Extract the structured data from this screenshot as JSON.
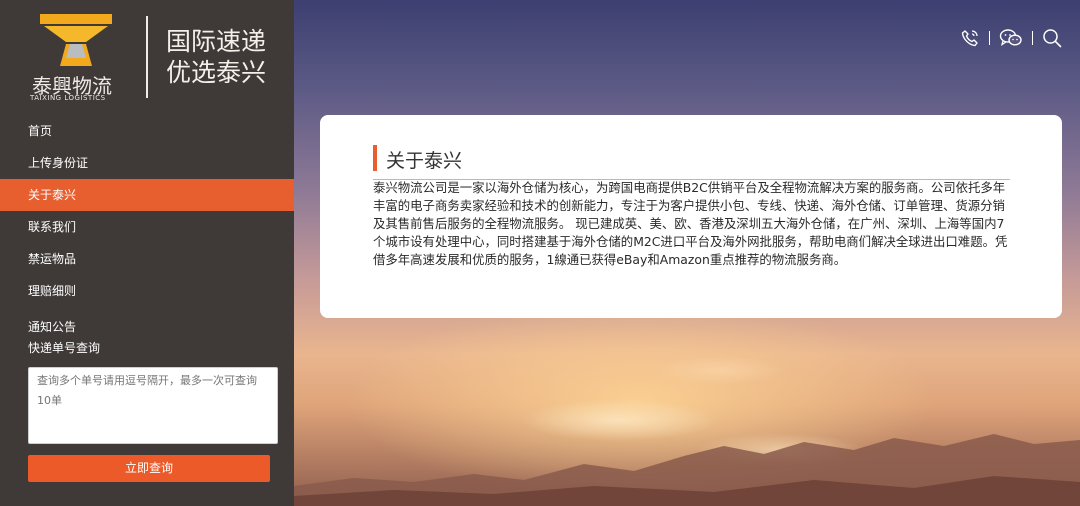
{
  "brand": {
    "logo_cn": "泰興物流",
    "logo_en": "TAIXING LOGISTICS",
    "slogan_line1": "国际速递",
    "slogan_line2": "优选泰兴",
    "logo_color": "#f2a91c"
  },
  "sidebar": {
    "items": [
      {
        "label": "首页",
        "active": false
      },
      {
        "label": "上传身份证",
        "active": false
      },
      {
        "label": "关于泰兴",
        "active": true
      },
      {
        "label": "联系我们",
        "active": false
      },
      {
        "label": "禁运物品",
        "active": false
      },
      {
        "label": "理赔细则",
        "active": false
      },
      {
        "label": "通知公告",
        "active": false
      }
    ],
    "query": {
      "label": "快递单号查询",
      "placeholder": "查询多个单号请用逗号隔开，最多一次可查询10单",
      "button_label": "立即查询"
    }
  },
  "top_icons": [
    "phone-icon",
    "wechat-icon",
    "search-icon"
  ],
  "content": {
    "title": "关于泰兴",
    "paragraph": "泰兴物流公司是一家以海外仓储为核心，为跨国电商提供B2C供销平台及全程物流解决方案的服务商。公司依托多年丰富的电子商务卖家经验和技术的创新能力，专注于为客户提供小包、专线、快递、海外仓储、订单管理、货源分销及其售前售后服务的全程物流服务。 现已建成英、美、欧、香港及深圳五大海外仓储，在广州、深圳、上海等国内7个城市设有处理中心，同时搭建基于海外仓储的M2C进口平台及海外网批服务，帮助电商们解决全球进出口难题。凭借多年高速发展和优质的服务，1線通已获得eBay和Amazon重点推荐的物流服务商。"
  },
  "colors": {
    "accent": "#e75e2f",
    "sidebar_bg": "#3f3a38",
    "card_bg": "#ffffff"
  }
}
